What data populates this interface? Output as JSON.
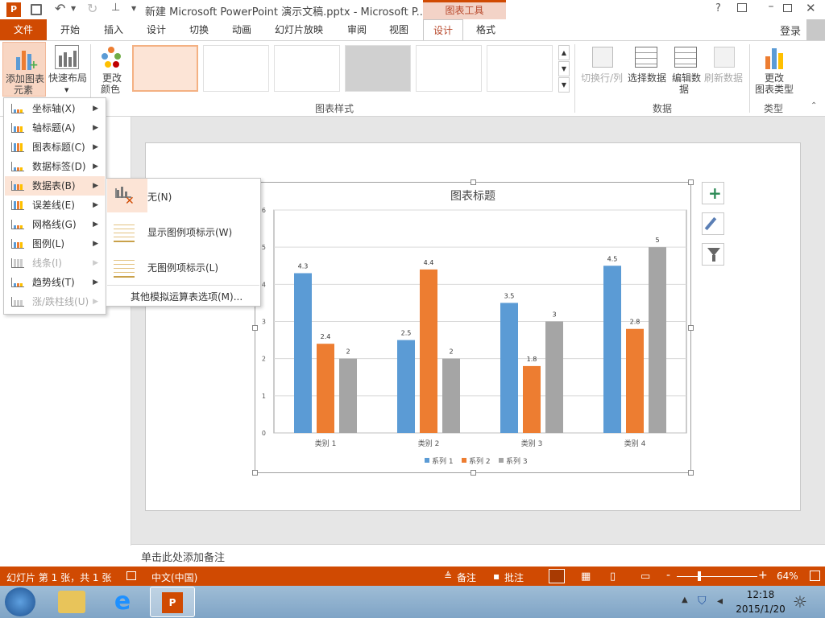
{
  "window": {
    "title": "新建 Microsoft PowerPoint 演示文稿.pptx - Microsoft P...",
    "context_header": "图表工具",
    "help": "?",
    "login": "登录"
  },
  "tabs": [
    {
      "label": "文件"
    },
    {
      "label": "开始"
    },
    {
      "label": "插入"
    },
    {
      "label": "设计"
    },
    {
      "label": "切换"
    },
    {
      "label": "动画"
    },
    {
      "label": "幻灯片放映"
    },
    {
      "label": "审阅"
    },
    {
      "label": "视图"
    },
    {
      "label": "设计"
    },
    {
      "label": "格式"
    }
  ],
  "ribbon": {
    "add_element": "添加图表",
    "add_element2": "元素",
    "quick_layout": "快速布局",
    "change_color": "更改",
    "change_color2": "颜色",
    "chart_styles_label": "图表样式",
    "switch_row_col": "切换行/列",
    "select_data": "选择数据",
    "edit_data": "编辑数",
    "edit_data2": "据",
    "refresh_data": "刷新数据",
    "data_label": "数据",
    "change_type": "更改",
    "change_type2": "图表类型",
    "type_label": "类型"
  },
  "menu": {
    "items": [
      {
        "label": "坐标轴(X)",
        "disabled": false
      },
      {
        "label": "轴标题(A)",
        "disabled": false
      },
      {
        "label": "图表标题(C)",
        "disabled": false
      },
      {
        "label": "数据标签(D)",
        "disabled": false
      },
      {
        "label": "数据表(B)",
        "disabled": false
      },
      {
        "label": "误差线(E)",
        "disabled": false
      },
      {
        "label": "网格线(G)",
        "disabled": false
      },
      {
        "label": "图例(L)",
        "disabled": false
      },
      {
        "label": "线条(I)",
        "disabled": true
      },
      {
        "label": "趋势线(T)",
        "disabled": false
      },
      {
        "label": "涨/跌柱线(U)",
        "disabled": true
      }
    ],
    "submenu": {
      "items": [
        {
          "label": "无(N)"
        },
        {
          "label": "显示图例项标示(W)"
        },
        {
          "label": "无图例项标示(L)"
        }
      ],
      "more": "其他模拟运算表选项(M)..."
    }
  },
  "chart_data": {
    "type": "bar",
    "title": "图表标题",
    "categories": [
      "类别 1",
      "类别 2",
      "类别 3",
      "类别 4"
    ],
    "series": [
      {
        "name": "系列 1",
        "values": [
          4.3,
          2.5,
          3.5,
          4.5
        ],
        "color": "#5b9bd5"
      },
      {
        "name": "系列 2",
        "values": [
          2.4,
          4.4,
          1.8,
          2.8
        ],
        "color": "#ed7d31"
      },
      {
        "name": "系列 3",
        "values": [
          2,
          2,
          3,
          5
        ],
        "color": "#a5a5a5"
      }
    ],
    "ylim": [
      0,
      6
    ],
    "yticks": [
      "0",
      "1",
      "2",
      "3",
      "4",
      "5",
      "6"
    ],
    "grid": true,
    "legend": "bottom"
  },
  "notes": {
    "placeholder": "单击此处添加备注"
  },
  "status": {
    "slide_info": "幻灯片 第 1 张，共 1 张",
    "language": "中文(中国)",
    "notes_btn": "备注",
    "comments_btn": "批注",
    "zoom": "64%"
  },
  "taskbar": {
    "time": "12:18",
    "date": "2015/1/20"
  },
  "colors": {
    "accent": "#d04a02",
    "highlight": "#fce4d6"
  }
}
